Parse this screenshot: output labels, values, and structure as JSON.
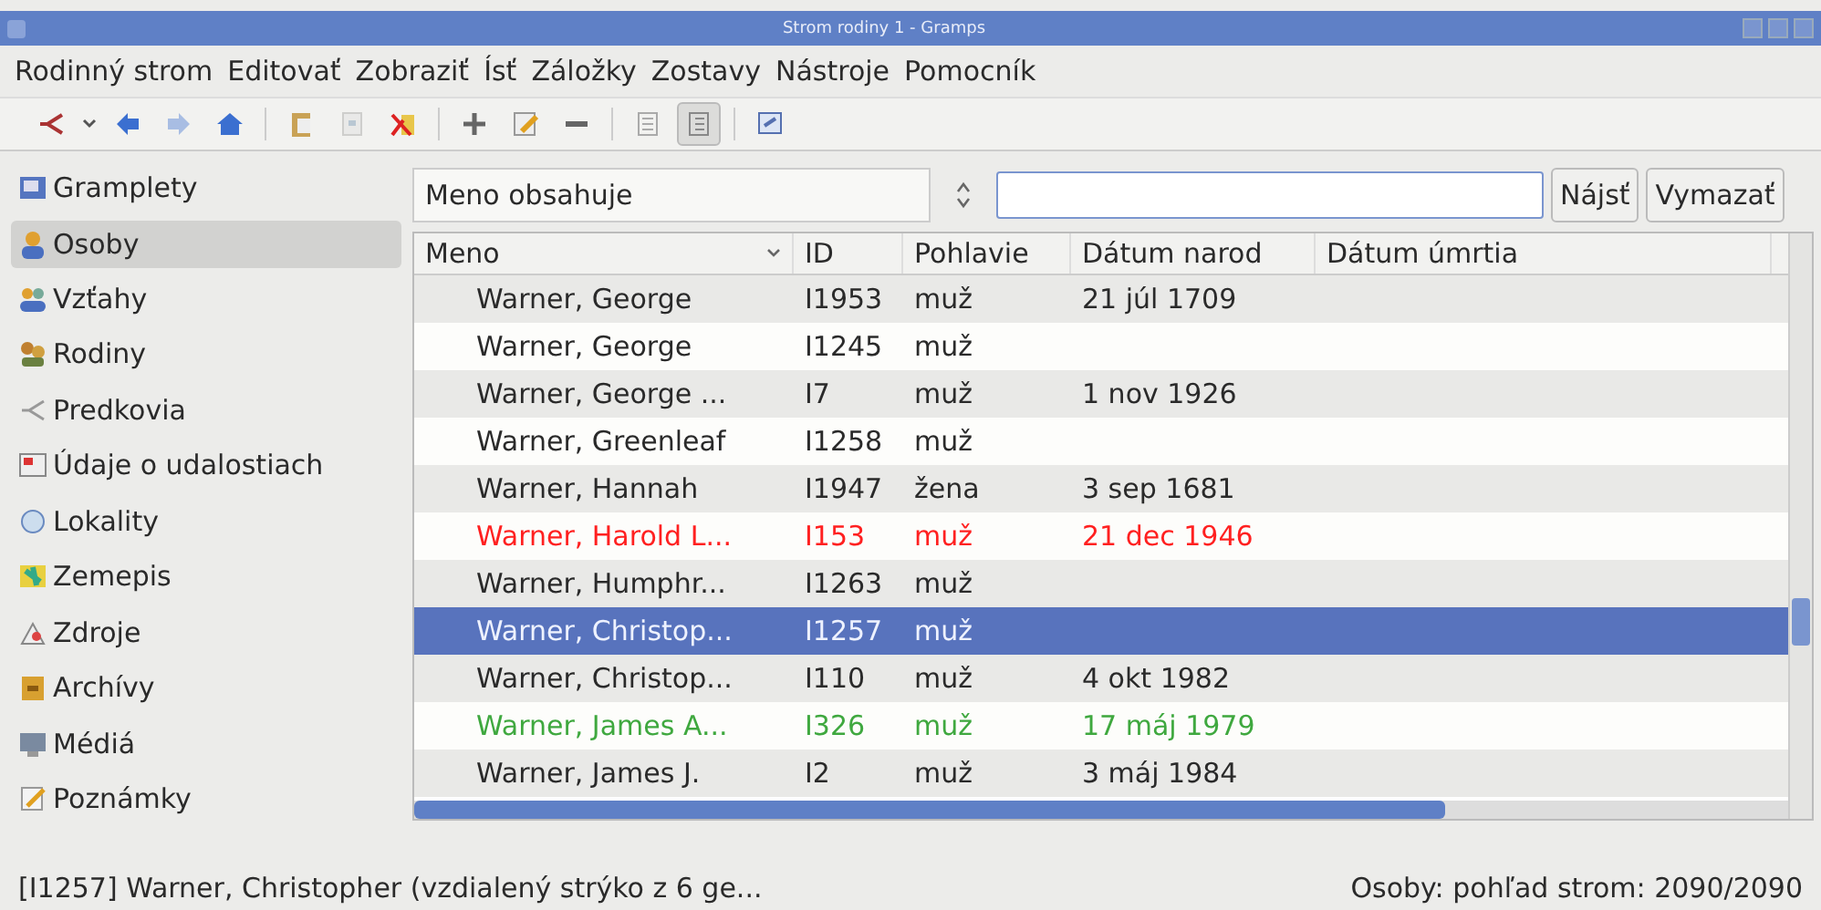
{
  "window": {
    "title": "Strom rodiny 1 - Gramps"
  },
  "menu": [
    "Rodinný strom",
    "Editovať",
    "Zobraziť",
    "Ísť",
    "Záložky",
    "Zostavy",
    "Nástroje",
    "Pomocník"
  ],
  "toolbar": [
    {
      "kind": "tree",
      "disabled": false
    },
    {
      "kind": "caret"
    },
    {
      "kind": "back",
      "disabled": false
    },
    {
      "kind": "forward",
      "disabled": true
    },
    {
      "kind": "home",
      "disabled": false
    },
    {
      "kind": "sep"
    },
    {
      "kind": "clipboard",
      "disabled": false
    },
    {
      "kind": "card",
      "disabled": true
    },
    {
      "kind": "merge",
      "disabled": false
    },
    {
      "kind": "sep"
    },
    {
      "kind": "plus",
      "disabled": false
    },
    {
      "kind": "edit",
      "disabled": false
    },
    {
      "kind": "minus",
      "disabled": false
    },
    {
      "kind": "sep"
    },
    {
      "kind": "grouped",
      "selected": false
    },
    {
      "kind": "flat",
      "selected": true
    },
    {
      "kind": "sep"
    },
    {
      "kind": "config",
      "disabled": false
    }
  ],
  "sidebar": {
    "items": [
      {
        "label": "Gramplety",
        "selected": false
      },
      {
        "label": "Osoby",
        "selected": true
      },
      {
        "label": "Vzťahy",
        "selected": false
      },
      {
        "label": "Rodiny",
        "selected": false
      },
      {
        "label": "Predkovia",
        "selected": false
      },
      {
        "label": "Údaje o udalostiach",
        "selected": false
      },
      {
        "label": "Lokality",
        "selected": false
      },
      {
        "label": "Zemepis",
        "selected": false
      },
      {
        "label": "Zdroje",
        "selected": false
      },
      {
        "label": "Archívy",
        "selected": false
      },
      {
        "label": "Médiá",
        "selected": false
      },
      {
        "label": "Poznámky",
        "selected": false
      }
    ]
  },
  "filter": {
    "combo": "Meno obsahuje",
    "buttons": [
      "Nájsť",
      "Vymazať"
    ]
  },
  "table": {
    "columns": [
      {
        "label": "Meno",
        "sorted": true
      },
      {
        "label": "ID",
        "sorted": false
      },
      {
        "label": "Pohlavie",
        "sorted": false
      },
      {
        "label": "Dátum narod",
        "sorted": false
      },
      {
        "label": "Dátum úmrtia",
        "sorted": false
      }
    ],
    "rows": [
      {
        "cells": [
          "Warner, George",
          "I1953",
          "muž",
          "21 júl 1709",
          ""
        ],
        "selected": false
      },
      {
        "cells": [
          "Warner, George",
          "I1245",
          "muž",
          "",
          ""
        ],
        "selected": false
      },
      {
        "cells": [
          "Warner, George ...",
          "I7",
          "muž",
          "1 nov 1926",
          ""
        ],
        "selected": false
      },
      {
        "cells": [
          "Warner, Greenleaf",
          "I1258",
          "muž",
          "",
          ""
        ],
        "selected": false
      },
      {
        "cells": [
          "Warner, Hannah",
          "I1947",
          "žena",
          "3 sep 1681",
          ""
        ],
        "selected": false
      },
      {
        "cells": [
          "Warner, Harold L...",
          "I153",
          "muž",
          "21 dec 1946",
          ""
        ],
        "selected": false,
        "color": "#ff2020"
      },
      {
        "cells": [
          "Warner, Humphr...",
          "I1263",
          "muž",
          "",
          ""
        ],
        "selected": false
      },
      {
        "cells": [
          "Warner, Christop...",
          "I1257",
          "muž",
          "",
          ""
        ],
        "selected": true
      },
      {
        "cells": [
          "Warner, Christop...",
          "I110",
          "muž",
          "4 okt 1982",
          ""
        ],
        "selected": false
      },
      {
        "cells": [
          "Warner, James A...",
          "I326",
          "muž",
          "17 máj 1979",
          ""
        ],
        "selected": false,
        "color": "#3fa83f"
      },
      {
        "cells": [
          "Warner, James J.",
          "I2",
          "muž",
          "3 máj 1984",
          ""
        ],
        "selected": false
      }
    ]
  },
  "status_bar": {
    "left": "[I1257] Warner, Christopher (vzdialený strýko z 6 ge...",
    "right": "Osoby: pohľad strom: 2090/2090"
  }
}
